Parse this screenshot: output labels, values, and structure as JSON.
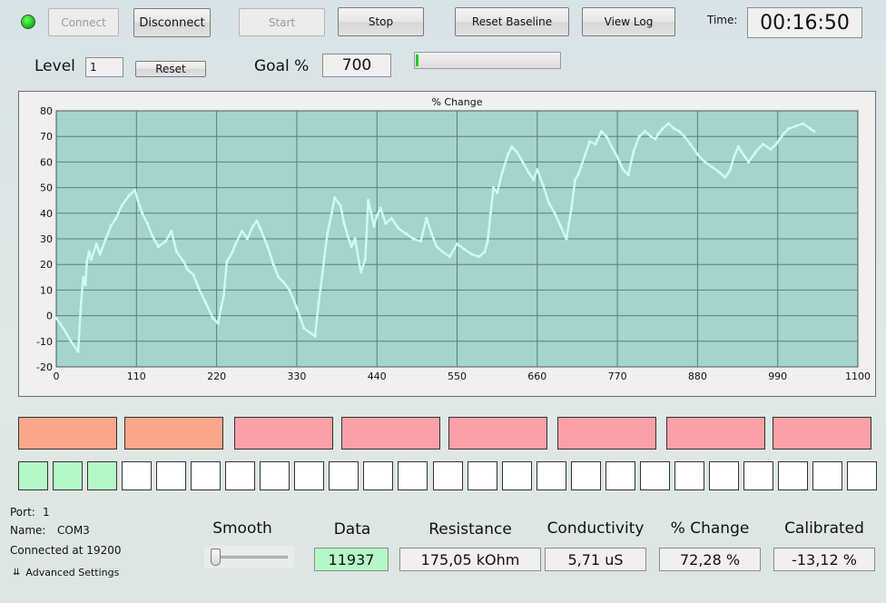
{
  "toolbar": {
    "connect_label": "Connect",
    "disconnect_label": "Disconnect",
    "start_label": "Start",
    "stop_label": "Stop",
    "reset_baseline_label": "Reset Baseline",
    "view_log_label": "View Log",
    "time_label": "Time:",
    "time_value": "00:16:50"
  },
  "level": {
    "label": "Level",
    "value": "1",
    "reset_label": "Reset"
  },
  "goal": {
    "label": "Goal %",
    "value": "700",
    "progress_fraction": 0.02,
    "progress_color": "#23c823"
  },
  "chart_data": {
    "type": "scatter",
    "title": "% Change",
    "xlabel": "",
    "ylabel": "",
    "xlim": [
      0,
      1100
    ],
    "ylim": [
      -20,
      80
    ],
    "xticks": [
      0,
      110,
      220,
      330,
      440,
      550,
      660,
      770,
      880,
      990,
      1100
    ],
    "yticks": [
      -20,
      -10,
      0,
      10,
      20,
      30,
      40,
      50,
      60,
      70,
      80
    ],
    "grid": true,
    "plot_bg": "#a4d4cc",
    "point_color": "#c8fff8",
    "series": [
      {
        "x": [
          0,
          10,
          20,
          30,
          34,
          37,
          40,
          42,
          45,
          48,
          55,
          60,
          68,
          75,
          82,
          90,
          100,
          108,
          112,
          118,
          125,
          132,
          140,
          150,
          158,
          165,
          175,
          180,
          188,
          195,
          205,
          215,
          222,
          226,
          230,
          234,
          242,
          246,
          255,
          262,
          270,
          275,
          280,
          290,
          298,
          305,
          312,
          320,
          330,
          340,
          350,
          355,
          360,
          365,
          368,
          372,
          378,
          382,
          390,
          395,
          400,
          405,
          410,
          418,
          424,
          428,
          432,
          436,
          440,
          445,
          452,
          460,
          470,
          480,
          490,
          500,
          508,
          515,
          522,
          530,
          540,
          550,
          560,
          570,
          580,
          588,
          592,
          596,
          600,
          605,
          612,
          620,
          625,
          632,
          640,
          648,
          655,
          660,
          668,
          676,
          684,
          692,
          700,
          707,
          712,
          716,
          720,
          726,
          732,
          740,
          748,
          755,
          762,
          768,
          773,
          778,
          785,
          792,
          800,
          808,
          816,
          822,
          826,
          832,
          840,
          848,
          855,
          862,
          870,
          880,
          890,
          900,
          910,
          918,
          925,
          930,
          936,
          940,
          945,
          950,
          960,
          970,
          980,
          988,
          993,
          998,
          1005,
          1015,
          1025,
          1035,
          1040
        ],
        "y": [
          -1,
          -5,
          -10,
          -14,
          5,
          15,
          12,
          21,
          25,
          22,
          28,
          24,
          30,
          35,
          38,
          43,
          47,
          49,
          45,
          40,
          36,
          31,
          27,
          29,
          33,
          25,
          21,
          18,
          16,
          11,
          5,
          -1,
          -3,
          3,
          8,
          21,
          25,
          28,
          33,
          30,
          35,
          37,
          34,
          27,
          20,
          15,
          13,
          10,
          3,
          -5,
          -7,
          -8,
          5,
          16,
          23,
          32,
          40,
          46,
          43,
          36,
          31,
          27,
          30,
          17,
          22,
          45,
          40,
          35,
          39,
          42,
          36,
          38,
          34,
          32,
          30,
          29,
          38,
          32,
          27,
          25,
          23,
          28,
          26,
          24,
          23,
          25,
          29,
          40,
          50,
          48,
          56,
          63,
          66,
          64,
          60,
          56,
          53,
          57,
          51,
          44,
          40,
          35,
          30,
          42,
          53,
          55,
          58,
          63,
          68,
          67,
          72,
          70,
          66,
          63,
          60,
          57,
          55,
          64,
          70,
          72,
          70,
          69,
          71,
          73,
          75,
          73,
          72,
          70,
          67,
          63,
          60,
          58,
          56,
          54,
          57,
          62,
          66,
          64,
          62,
          60,
          64,
          67,
          65,
          67,
          69,
          71,
          73,
          74,
          75,
          73,
          72
        ]
      }
    ]
  },
  "indicators": {
    "top_row_colors": [
      "#fba68c",
      "#fba68c",
      "#fba0a8",
      "#fba0a8",
      "#fba0a8",
      "#fba0a8",
      "#fba0a8",
      "#fba0a8"
    ],
    "bottom_row_colors": [
      "#b6f7c8",
      "#b6f7c8",
      "#b6f7c8",
      "#ffffff",
      "#ffffff",
      "#ffffff",
      "#ffffff",
      "#ffffff",
      "#ffffff",
      "#ffffff",
      "#ffffff",
      "#ffffff",
      "#ffffff",
      "#ffffff",
      "#ffffff",
      "#ffffff",
      "#ffffff",
      "#ffffff",
      "#ffffff",
      "#ffffff",
      "#ffffff",
      "#ffffff",
      "#ffffff",
      "#ffffff",
      "#ffffff"
    ]
  },
  "port": {
    "port_label": "Port:",
    "port_value": "1",
    "name_label": "Name:",
    "name_value": "COM3",
    "connected_text": "Connected at 19200",
    "advanced_label": "Advanced Settings"
  },
  "meters": {
    "smooth_label": "Smooth",
    "smooth_fraction": 0.0,
    "data_label": "Data",
    "data_value": "11937",
    "resistance_label": "Resistance",
    "resistance_value": "175,05 kOhm",
    "conductivity_label": "Conductivity",
    "conductivity_value": "5,71 uS",
    "change_label": "% Change",
    "change_value": "72,28 %",
    "calibrated_label": "Calibrated",
    "calibrated_value": "-13,12 %"
  }
}
